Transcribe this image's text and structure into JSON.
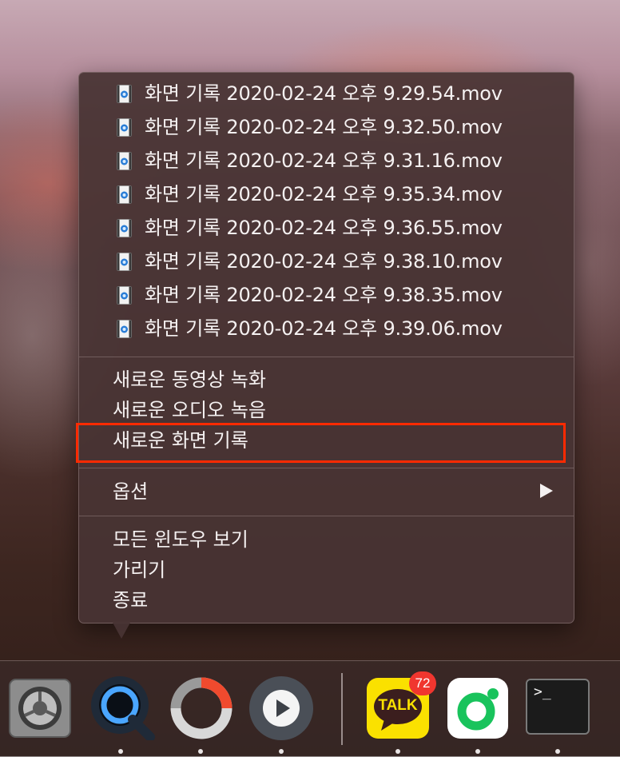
{
  "menu": {
    "recent_files": [
      {
        "label": "화면 기록 2020-02-24 오후 9.29.54.mov"
      },
      {
        "label": "화면 기록 2020-02-24 오후 9.32.50.mov"
      },
      {
        "label": "화면 기록 2020-02-24 오후 9.31.16.mov"
      },
      {
        "label": "화면 기록 2020-02-24 오후 9.35.34.mov"
      },
      {
        "label": "화면 기록 2020-02-24 오후 9.36.55.mov"
      },
      {
        "label": "화면 기록 2020-02-24 오후 9.38.10.mov"
      },
      {
        "label": "화면 기록 2020-02-24 오후 9.38.35.mov"
      },
      {
        "label": "화면 기록 2020-02-24 오후 9.39.06.mov"
      }
    ],
    "new_actions": {
      "new_movie_recording": "새로운 동영상 녹화",
      "new_audio_recording": "새로운 오디오 녹음",
      "new_screen_recording": "새로운 화면 기록"
    },
    "options": "옵션",
    "window_actions": {
      "show_all_windows": "모든 윈도우 보기",
      "hide": "가리기",
      "quit": "종료"
    }
  },
  "dock": {
    "apps": [
      {
        "icon": "system-preferences-icon"
      },
      {
        "icon": "quicktime-icon"
      },
      {
        "icon": "screen-recorder-icon"
      },
      {
        "icon": "media-player-icon"
      },
      {
        "icon": "kakaotalk-icon",
        "badge": "72"
      },
      {
        "icon": "naver-band-icon"
      },
      {
        "icon": "terminal-icon"
      }
    ],
    "kakaotalk_label": "TALK",
    "terminal_prompt": ">_"
  },
  "colors": {
    "highlight_border": "#ff2a00",
    "kakao_yellow": "#fae100",
    "badge_red": "#f0362f"
  }
}
